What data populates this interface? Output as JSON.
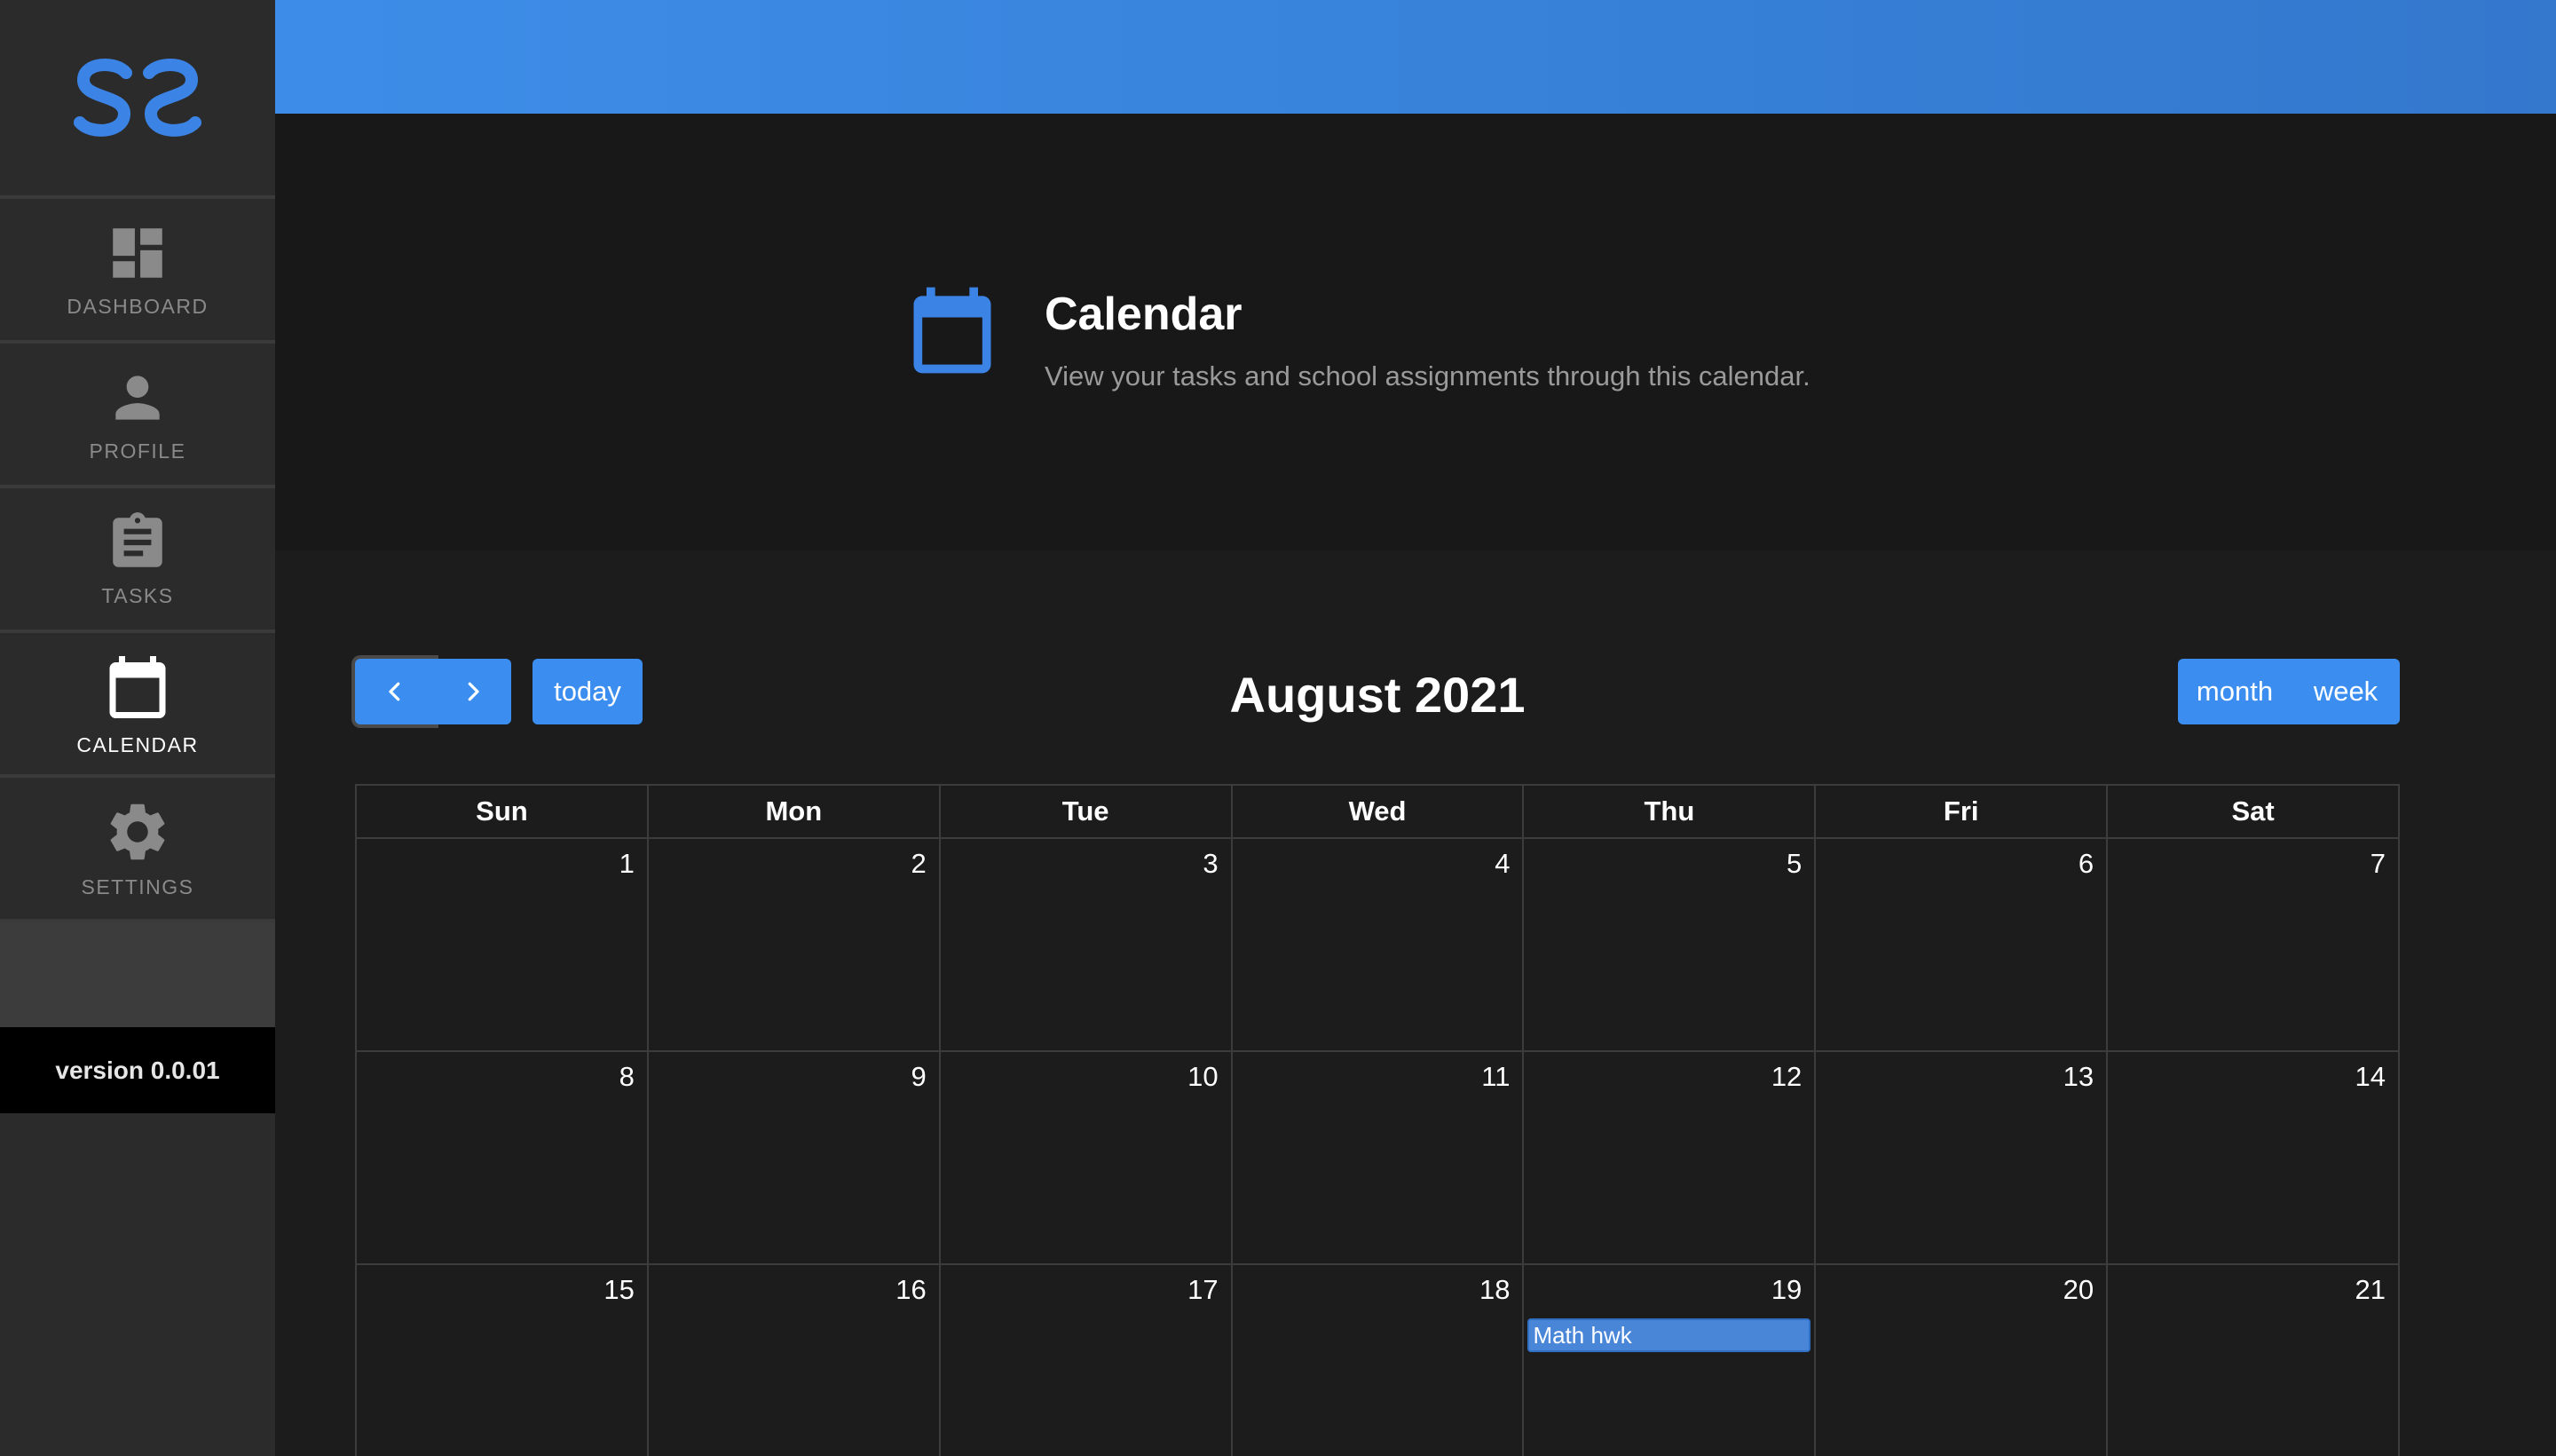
{
  "colors": {
    "accent": "#3b8ef0",
    "sidebar_bg": "#2b2b2b",
    "main_bg": "#1c1c1c",
    "header_bg": "#181818",
    "event_bg": "#4a86d8",
    "nav_inactive": "#8a8a8a"
  },
  "sidebar": {
    "logo_icon": "ss-logo-icon",
    "items": [
      {
        "label": "DASHBOARD",
        "icon": "dashboard-icon",
        "active": false
      },
      {
        "label": "PROFILE",
        "icon": "person-icon",
        "active": false
      },
      {
        "label": "TASKS",
        "icon": "clipboard-icon",
        "active": false
      },
      {
        "label": "CALENDAR",
        "icon": "calendar-icon",
        "active": true
      },
      {
        "label": "SETTINGS",
        "icon": "gear-icon",
        "active": false
      }
    ],
    "version": "version 0.0.01"
  },
  "header": {
    "icon": "calendar-icon",
    "title": "Calendar",
    "subtitle": "View your tasks and school assignments through this calendar."
  },
  "calendar": {
    "title": "August 2021",
    "prev_icon": "chevron-left-icon",
    "next_icon": "chevron-right-icon",
    "today_label": "today",
    "view_month_label": "month",
    "view_week_label": "week",
    "weekdays": [
      "Sun",
      "Mon",
      "Tue",
      "Wed",
      "Thu",
      "Fri",
      "Sat"
    ],
    "weeks": [
      [
        "1",
        "2",
        "3",
        "4",
        "5",
        "6",
        "7"
      ],
      [
        "8",
        "9",
        "10",
        "11",
        "12",
        "13",
        "14"
      ],
      [
        "15",
        "16",
        "17",
        "18",
        "19",
        "20",
        "21"
      ]
    ],
    "events": [
      {
        "date": "19",
        "title": "Math hwk"
      }
    ]
  }
}
